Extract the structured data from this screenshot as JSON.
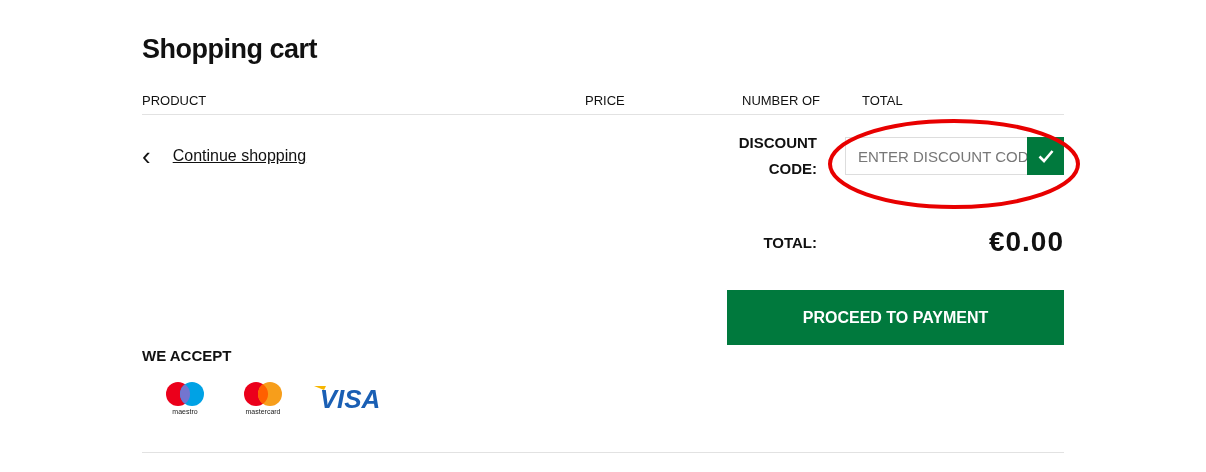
{
  "title": "Shopping cart",
  "columns": [
    "PRODUCT",
    "PRICE",
    "NUMBER OF",
    "TOTAL"
  ],
  "continue_link": {
    "icon": "‹",
    "label": "Continue shopping"
  },
  "discount": {
    "label": "DISCOUNT CODE:",
    "placeholder": "ENTER DISCOUNT COD"
  },
  "total": {
    "label": "TOTAL:",
    "value": "€0.00"
  },
  "proceed_button": "PROCEED TO PAYMENT",
  "payment": {
    "title": "WE ACCEPT",
    "methods": [
      {
        "kind": "maestro",
        "label": "maestro"
      },
      {
        "kind": "mastercard",
        "label": "mastercard"
      },
      {
        "kind": "visa",
        "label": "VISA"
      }
    ]
  },
  "highlight": {
    "kind": "ellipse"
  }
}
